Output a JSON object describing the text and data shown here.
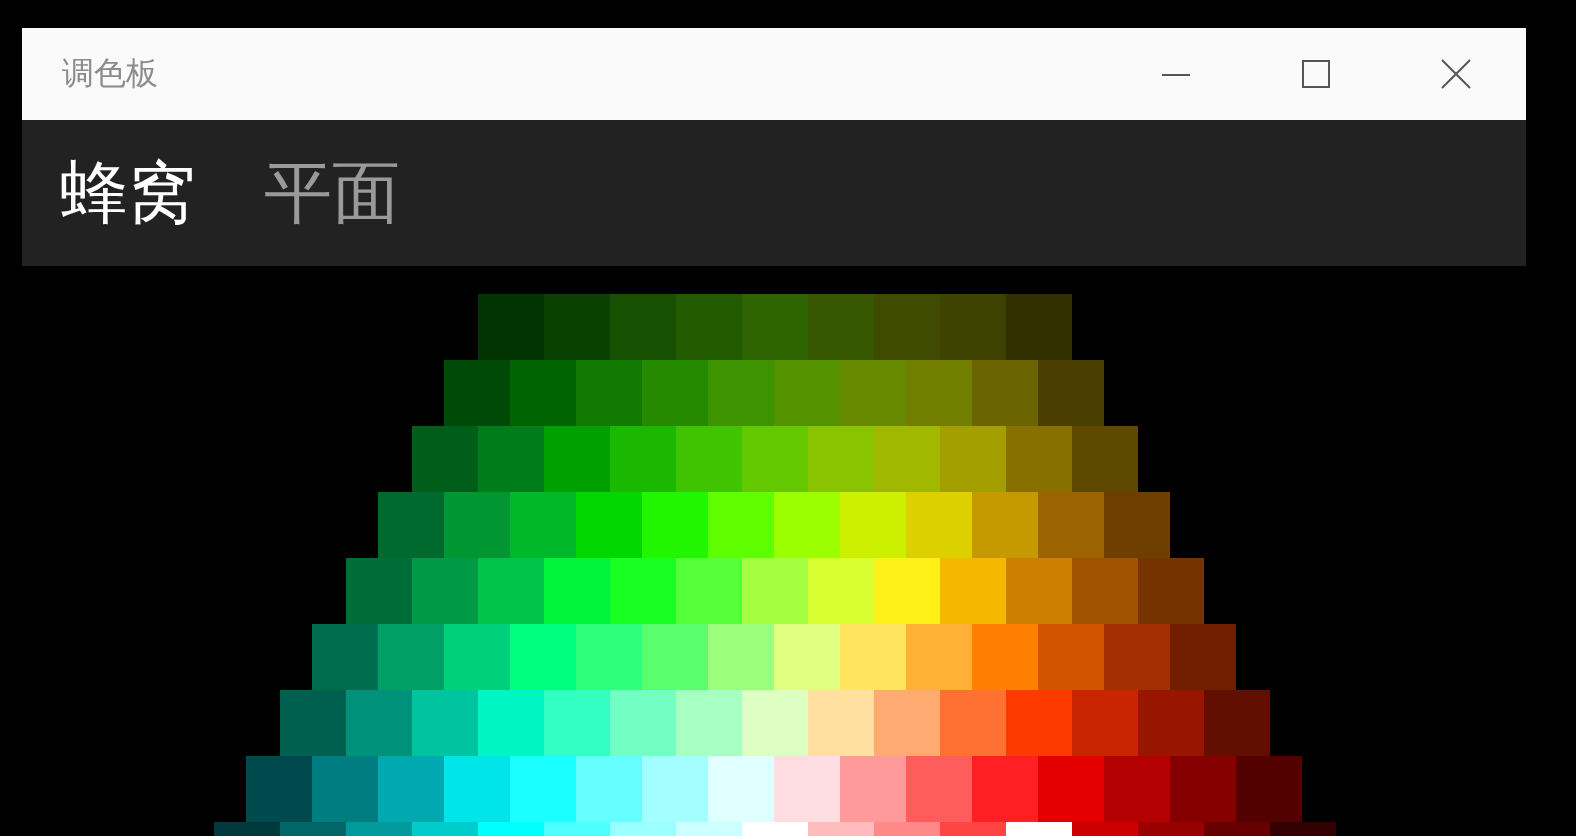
{
  "window": {
    "title": "调色板"
  },
  "tabs": [
    {
      "label": "蜂窝",
      "selected": true
    },
    {
      "label": "平面",
      "selected": false
    }
  ],
  "rows": [
    {
      "swatches": [
        {
          "color": "#003300",
          "selected": false
        },
        {
          "color": "#0a4000",
          "selected": false
        },
        {
          "color": "#165000",
          "selected": false
        },
        {
          "color": "#225a00",
          "selected": false
        },
        {
          "color": "#2d6300",
          "selected": false
        },
        {
          "color": "#385800",
          "selected": false
        },
        {
          "color": "#3f4c00",
          "selected": false
        },
        {
          "color": "#3e4200",
          "selected": false
        },
        {
          "color": "#333000",
          "selected": false
        }
      ]
    },
    {
      "swatches": [
        {
          "color": "#004a08",
          "selected": false
        },
        {
          "color": "#006400",
          "selected": false
        },
        {
          "color": "#117a00",
          "selected": false
        },
        {
          "color": "#268a00",
          "selected": false
        },
        {
          "color": "#3e9400",
          "selected": false
        },
        {
          "color": "#559200",
          "selected": false
        },
        {
          "color": "#678a00",
          "selected": false
        },
        {
          "color": "#717e00",
          "selected": false
        },
        {
          "color": "#6b6400",
          "selected": false
        },
        {
          "color": "#4a3f00",
          "selected": false
        }
      ]
    },
    {
      "swatches": [
        {
          "color": "#005e1a",
          "selected": false
        },
        {
          "color": "#007d1a",
          "selected": false
        },
        {
          "color": "#00a000",
          "selected": false
        },
        {
          "color": "#1ab900",
          "selected": false
        },
        {
          "color": "#40c300",
          "selected": false
        },
        {
          "color": "#64c800",
          "selected": false
        },
        {
          "color": "#8ac400",
          "selected": false
        },
        {
          "color": "#a0b800",
          "selected": false
        },
        {
          "color": "#a49f00",
          "selected": false
        },
        {
          "color": "#877000",
          "selected": false
        },
        {
          "color": "#5f4800",
          "selected": false
        }
      ]
    },
    {
      "swatches": [
        {
          "color": "#006a2e",
          "selected": false
        },
        {
          "color": "#009632",
          "selected": false
        },
        {
          "color": "#00b82a",
          "selected": false
        },
        {
          "color": "#00d600",
          "selected": false
        },
        {
          "color": "#22f500",
          "selected": false
        },
        {
          "color": "#5fff00",
          "selected": false
        },
        {
          "color": "#9cff00",
          "selected": false
        },
        {
          "color": "#cdf000",
          "selected": false
        },
        {
          "color": "#ddd000",
          "selected": false
        },
        {
          "color": "#c49a00",
          "selected": false
        },
        {
          "color": "#9c6400",
          "selected": false
        },
        {
          "color": "#6e3f00",
          "selected": false
        }
      ]
    },
    {
      "swatches": [
        {
          "color": "#006c38",
          "selected": false
        },
        {
          "color": "#009a46",
          "selected": false
        },
        {
          "color": "#00c44a",
          "selected": false
        },
        {
          "color": "#00f53a",
          "selected": false
        },
        {
          "color": "#1aff22",
          "selected": false
        },
        {
          "color": "#55ff3a",
          "selected": false
        },
        {
          "color": "#a3ff40",
          "selected": false
        },
        {
          "color": "#d9ff30",
          "selected": false
        },
        {
          "color": "#fff01a",
          "selected": false
        },
        {
          "color": "#f5b800",
          "selected": false
        },
        {
          "color": "#cd7f00",
          "selected": false
        },
        {
          "color": "#a15200",
          "selected": false
        },
        {
          "color": "#753300",
          "selected": false
        }
      ]
    },
    {
      "swatches": [
        {
          "color": "#006e4e",
          "selected": false
        },
        {
          "color": "#009f66",
          "selected": false
        },
        {
          "color": "#00d07a",
          "selected": false
        },
        {
          "color": "#00ff7f",
          "selected": false
        },
        {
          "color": "#2dff7a",
          "selected": false
        },
        {
          "color": "#5aff6e",
          "selected": false
        },
        {
          "color": "#9bff7d",
          "selected": false
        },
        {
          "color": "#e0ff80",
          "selected": false
        },
        {
          "color": "#ffe55e",
          "selected": false
        },
        {
          "color": "#ffb036",
          "selected": false
        },
        {
          "color": "#ff7f00",
          "selected": false
        },
        {
          "color": "#d35400",
          "selected": false
        },
        {
          "color": "#a33000",
          "selected": false
        },
        {
          "color": "#711e00",
          "selected": false
        }
      ]
    },
    {
      "swatches": [
        {
          "color": "#006050",
          "selected": false
        },
        {
          "color": "#00917a",
          "selected": false
        },
        {
          "color": "#00c4a0",
          "selected": false
        },
        {
          "color": "#00f5c4",
          "selected": false
        },
        {
          "color": "#33ffc4",
          "selected": false
        },
        {
          "color": "#73ffc4",
          "selected": false
        },
        {
          "color": "#a8ffc4",
          "selected": false
        },
        {
          "color": "#ddffc4",
          "selected": false
        },
        {
          "color": "#ffe0a0",
          "selected": false
        },
        {
          "color": "#ffaa70",
          "selected": false
        },
        {
          "color": "#ff7033",
          "selected": false
        },
        {
          "color": "#ff3a00",
          "selected": false
        },
        {
          "color": "#c82500",
          "selected": false
        },
        {
          "color": "#981500",
          "selected": false
        },
        {
          "color": "#620e00",
          "selected": false
        }
      ]
    },
    {
      "swatches": [
        {
          "color": "#004a4e",
          "selected": false
        },
        {
          "color": "#007d80",
          "selected": false
        },
        {
          "color": "#00a8b0",
          "selected": false
        },
        {
          "color": "#00e5e8",
          "selected": false
        },
        {
          "color": "#1affff",
          "selected": false
        },
        {
          "color": "#66ffff",
          "selected": false
        },
        {
          "color": "#a3ffff",
          "selected": false
        },
        {
          "color": "#e0ffff",
          "selected": false
        },
        {
          "color": "#ffdde0",
          "selected": false
        },
        {
          "color": "#ff9a9a",
          "selected": false
        },
        {
          "color": "#ff5c5c",
          "selected": false
        },
        {
          "color": "#ff1f24",
          "selected": false
        },
        {
          "color": "#e50000",
          "selected": false
        },
        {
          "color": "#b50000",
          "selected": false
        },
        {
          "color": "#850000",
          "selected": false
        },
        {
          "color": "#520000",
          "selected": false
        }
      ]
    },
    {
      "swatches": [
        {
          "color": "#003a3c",
          "selected": false
        },
        {
          "color": "#006668",
          "selected": false
        },
        {
          "color": "#00999c",
          "selected": false
        },
        {
          "color": "#00cccc",
          "selected": false
        },
        {
          "color": "#00ffff",
          "selected": false
        },
        {
          "color": "#4dffff",
          "selected": false
        },
        {
          "color": "#99ffff",
          "selected": false
        },
        {
          "color": "#ccffff",
          "selected": false
        },
        {
          "color": "#ffffff",
          "selected": false
        },
        {
          "color": "#ffbbbb",
          "selected": false
        },
        {
          "color": "#ff8888",
          "selected": false
        },
        {
          "color": "#ff4444",
          "selected": false
        },
        {
          "color": "#ffffff",
          "selected": true
        },
        {
          "color": "#cc0000",
          "selected": false
        },
        {
          "color": "#990000",
          "selected": false
        },
        {
          "color": "#660000",
          "selected": false
        },
        {
          "color": "#330000",
          "selected": false
        }
      ]
    }
  ]
}
